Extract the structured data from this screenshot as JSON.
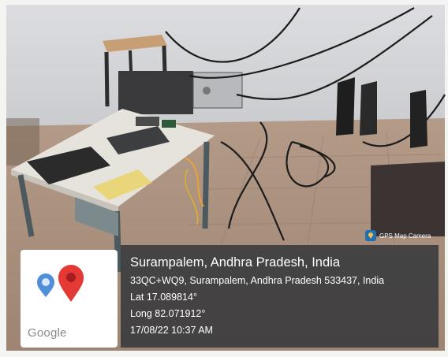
{
  "badge": {
    "label": "GPS Map Camera"
  },
  "map": {
    "brand": "Google"
  },
  "location": {
    "place": "Surampalem, Andhra Pradesh, India",
    "address": "33QC+WQ9, Surampalem, Andhra Pradesh 533437, India",
    "lat": "Lat 17.089814°",
    "long": "Long 82.071912°",
    "datetime": "17/08/22 10:37 AM"
  },
  "colors": {
    "overlay": "#34373a",
    "pin_red": "#e53935",
    "pin_blue": "#4f8fd9",
    "badge_blue": "#1f6fb3"
  }
}
